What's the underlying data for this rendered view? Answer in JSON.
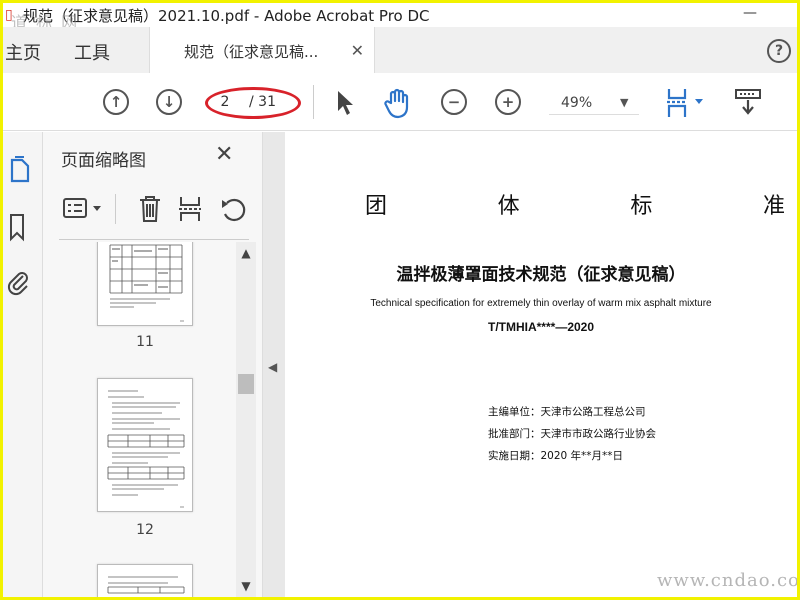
{
  "window": {
    "title": "规范（征求意见稿）2021.10.pdf - Adobe Acrobat Pro DC",
    "minimize_glyph": "—",
    "watermark_top": "道 标 网"
  },
  "tabs": {
    "home": "主页",
    "tools": "工具",
    "document": "规范（征求意见稿...",
    "close_glyph": "✕",
    "help_glyph": "?"
  },
  "toolbar": {
    "current_page": "2",
    "total_pages": "/ 31",
    "zoom": "49%",
    "prev_icon": "↑",
    "next_icon": "↓",
    "zoom_out_glyph": "−",
    "zoom_in_glyph": "+",
    "caret_glyph": "▼"
  },
  "sidebar": {
    "panel_title": "页面缩略图",
    "close_glyph": "✕",
    "thumbnails": [
      {
        "label": "11"
      },
      {
        "label": "12"
      }
    ]
  },
  "document": {
    "heading_chars": [
      "团",
      "体",
      "标",
      "准"
    ],
    "title": "温拌极薄罩面技术规范（征求意见稿）",
    "subtitle": "Technical specification for extremely thin overlay of warm mix asphalt mixture",
    "code": "T/TMHIA****—2020",
    "info_lines": [
      "主编单位：天津市公路工程总公司",
      "批准部门：天津市市政公路行业协会",
      "实施日期：2020 年**月**日"
    ]
  },
  "watermark_bottom": "www.cndao.com",
  "colors": {
    "accent_blue": "#2d74c9",
    "annotation_red": "#d8222a",
    "highlight_border": "#f2f200"
  }
}
